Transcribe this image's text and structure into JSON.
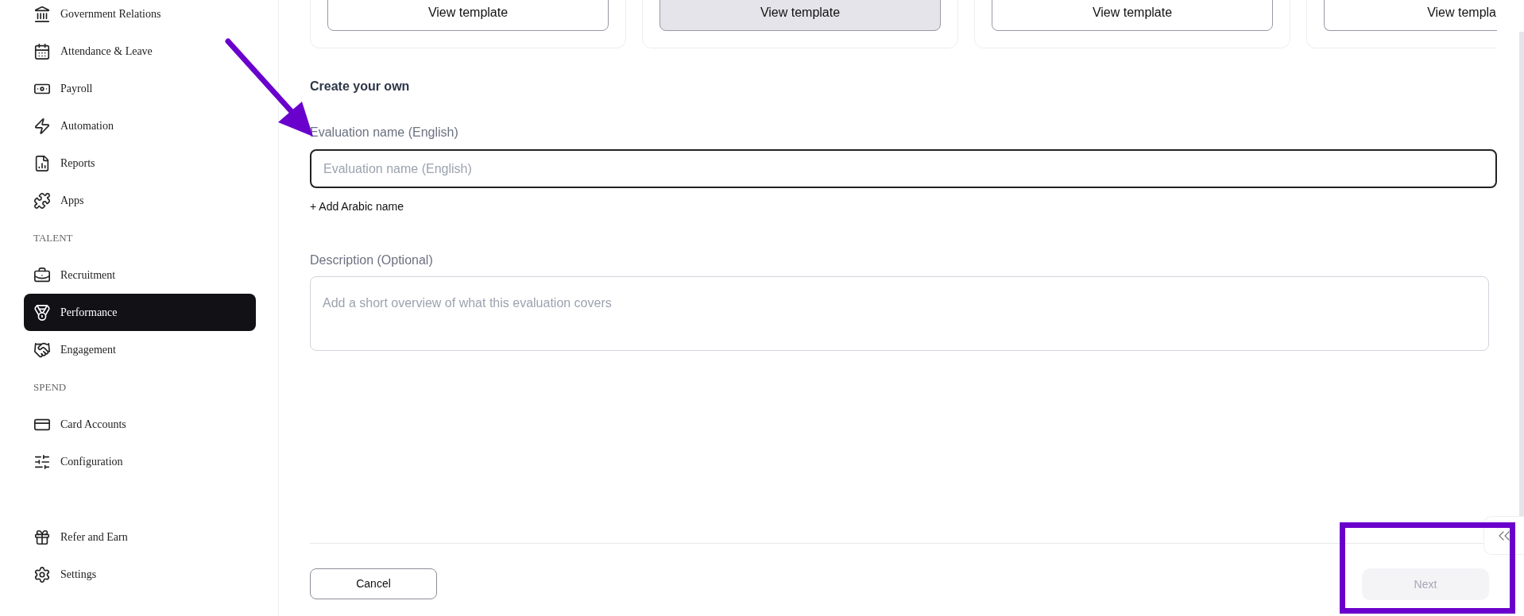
{
  "sidebar": {
    "items": [
      {
        "kind": "item",
        "label": "Government Relations",
        "selected": false
      },
      {
        "kind": "item",
        "label": "Attendance & Leave",
        "selected": false
      },
      {
        "kind": "item",
        "label": "Payroll",
        "selected": false
      },
      {
        "kind": "item",
        "label": "Automation",
        "selected": false
      },
      {
        "kind": "item",
        "label": "Reports",
        "selected": false
      },
      {
        "kind": "item",
        "label": "Apps",
        "selected": false
      },
      {
        "kind": "section",
        "label": "TALENT"
      },
      {
        "kind": "item",
        "label": "Recruitment",
        "selected": false
      },
      {
        "kind": "item",
        "label": "Performance",
        "selected": true
      },
      {
        "kind": "item",
        "label": "Engagement",
        "selected": false
      },
      {
        "kind": "section",
        "label": "SPEND"
      },
      {
        "kind": "item",
        "label": "Card Accounts",
        "selected": false
      },
      {
        "kind": "item",
        "label": "Configuration",
        "selected": false
      }
    ],
    "footer_items": [
      {
        "label": "Refer and Earn",
        "selected": false
      },
      {
        "label": "Settings",
        "selected": false
      }
    ]
  },
  "templates": [
    {
      "button": "View template",
      "hovered": false
    },
    {
      "button": "View template",
      "hovered": true
    },
    {
      "button": "View template",
      "hovered": false
    },
    {
      "button": "View templa",
      "hovered": false
    }
  ],
  "form": {
    "heading": "Create your own",
    "name_label": "Evaluation name (English)",
    "name_placeholder": "Evaluation name (English)",
    "add_arabic": "+ Add Arabic name",
    "description_label": "Description (Optional)",
    "description_placeholder": "Add a short overview of what this evaluation covers"
  },
  "footer": {
    "cancel": "Cancel",
    "next": "Next",
    "next_disabled": true
  }
}
